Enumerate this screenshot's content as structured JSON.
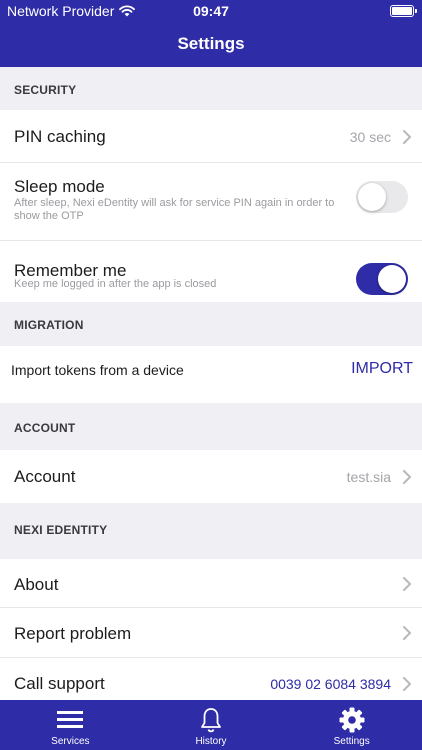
{
  "status_bar": {
    "carrier": "Network Provider",
    "time": "09:47"
  },
  "header": {
    "title": "Settings"
  },
  "sections": {
    "security": "SECURITY",
    "migration": "MIGRATION",
    "account": "ACCOUNT",
    "nexi": "NEXI EDENTITY"
  },
  "pin_caching": {
    "label": "PIN caching",
    "value": "30 sec"
  },
  "sleep_mode": {
    "label": "Sleep mode",
    "subtitle": "After sleep, Nexi eDentity will ask for service PIN again in order to show the OTP",
    "enabled": false
  },
  "remember_me": {
    "label": "Remember me",
    "subtitle": "Keep me logged in after the app is closed",
    "enabled": true
  },
  "import_tokens": {
    "label": "Import tokens from a device",
    "button": "IMPORT"
  },
  "account": {
    "label": "Account",
    "value": "test.sia"
  },
  "about": {
    "label": "About"
  },
  "report_problem": {
    "label": "Report problem"
  },
  "call_support": {
    "label": "Call support",
    "value": "0039 02 6084 3894"
  },
  "tabbar": {
    "services": "Services",
    "history": "History",
    "settings": "Settings"
  },
  "colors": {
    "brand": "#2e2ca6",
    "background": "#efeff4",
    "muted": "#a5a5aa"
  }
}
